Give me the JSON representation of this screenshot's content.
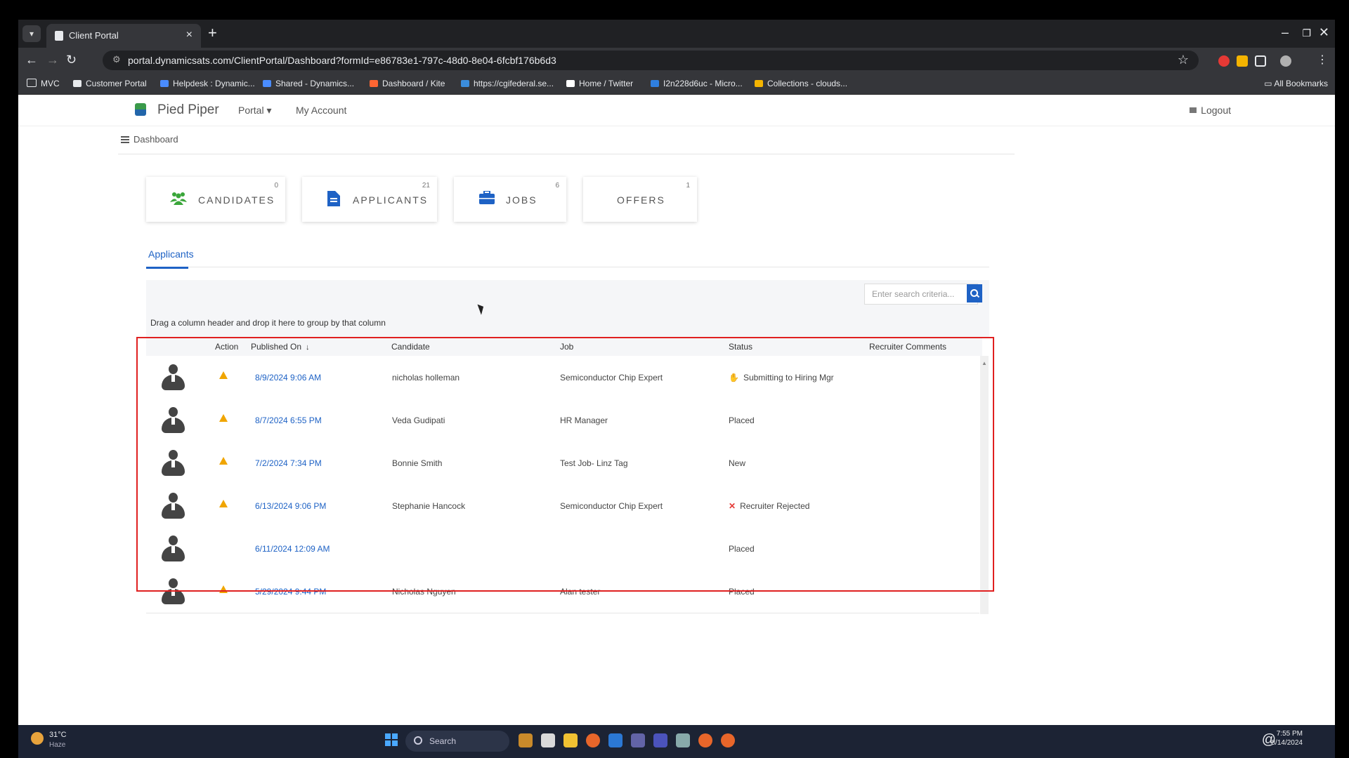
{
  "browser": {
    "tab_title": "Client Portal",
    "url": "portal.dynamicsats.com/ClientPortal/Dashboard?formId=e86783e1-797c-48d0-8e04-6fcbf176b6d3",
    "bookmarks": [
      {
        "label": "MVC",
        "color": "#9aa0a6"
      },
      {
        "label": "Customer Portal",
        "color": "#e8eaed"
      },
      {
        "label": "Helpdesk : Dynamic...",
        "color": "#4a8cff"
      },
      {
        "label": "Shared - Dynamics...",
        "color": "#4a8cff"
      },
      {
        "label": "Dashboard / Kite",
        "color": "#ff6633"
      },
      {
        "label": "https://cgifederal.se...",
        "color": "#3b8ddd"
      },
      {
        "label": "Home / Twitter",
        "color": "#ffffff"
      },
      {
        "label": "I2n228d6uc - Micro...",
        "color": "#2f7fe0"
      },
      {
        "label": "Collections - clouds...",
        "color": "#f4b400"
      }
    ],
    "all_bookmarks": "All Bookmarks"
  },
  "topnav": {
    "brand": "Pied Piper",
    "portal": "Portal ▾",
    "my_account": "My Account",
    "logout": "Logout"
  },
  "breadcrumb": "Dashboard",
  "cards": [
    {
      "label": "CANDIDATES",
      "count": "0",
      "icon": "users-icon",
      "color": "#3aa63a"
    },
    {
      "label": "APPLICANTS",
      "count": "21",
      "icon": "document-icon",
      "color": "#1e62c5"
    },
    {
      "label": "JOBS",
      "count": "6",
      "icon": "briefcase-icon",
      "color": "#1e62c5"
    },
    {
      "label": "OFFERS",
      "count": "1",
      "icon": "",
      "color": ""
    }
  ],
  "tabs": {
    "applicants": "Applicants"
  },
  "search": {
    "placeholder": "Enter search criteria..."
  },
  "grid": {
    "group_hint": "Drag a column header and drop it here to group by that column",
    "headers": {
      "action": "Action",
      "published_on": "Published On",
      "candidate": "Candidate",
      "job": "Job",
      "status": "Status",
      "recruiter_comments": "Recruiter Comments"
    },
    "sort_indicator": "↓",
    "rows": [
      {
        "date": "8/9/2024 9:06 AM",
        "candidate": "nicholas holleman",
        "job": "Semiconductor Chip Expert",
        "status": "Submitting to Hiring Mgr",
        "status_icon": "hand-icon",
        "warning": true
      },
      {
        "date": "8/7/2024 6:55 PM",
        "candidate": "Veda Gudipati",
        "job": "HR Manager",
        "status": "Placed",
        "status_icon": "",
        "warning": true
      },
      {
        "date": "7/2/2024 7:34 PM",
        "candidate": "Bonnie Smith",
        "job": "Test Job- Linz Tag",
        "status": "New",
        "status_icon": "",
        "warning": true
      },
      {
        "date": "6/13/2024 9:06 PM",
        "candidate": "Stephanie Hancock",
        "job": "Semiconductor Chip Expert",
        "status": "Recruiter Rejected",
        "status_icon": "x-icon",
        "warning": true
      },
      {
        "date": "6/11/2024 12:09 AM",
        "candidate": "",
        "job": "",
        "status": "Placed",
        "status_icon": "",
        "warning": false
      },
      {
        "date": "5/29/2024 9:44 PM",
        "candidate": "Nicholas Nguyen",
        "job": "Alan tester",
        "status": "Placed",
        "status_icon": "",
        "warning": true
      }
    ]
  },
  "taskbar": {
    "temp": "31°C",
    "condition": "Haze",
    "search": "Search",
    "time": "7:55 PM",
    "date": "8/14/2024"
  }
}
